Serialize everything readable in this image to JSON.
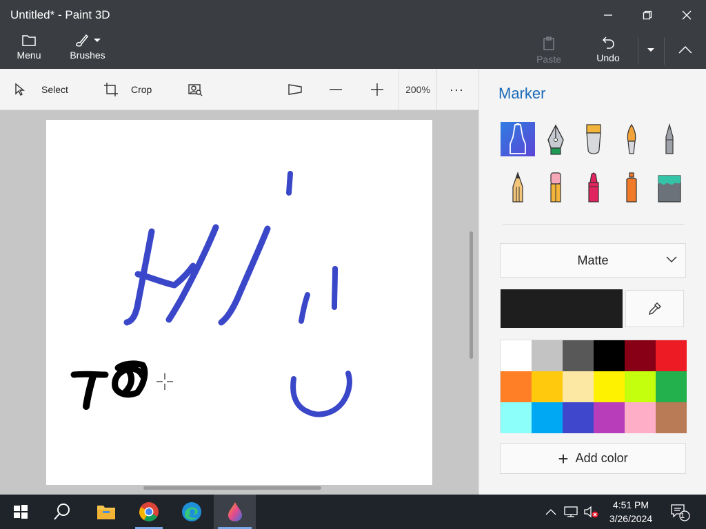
{
  "window": {
    "title": "Untitled* - Paint 3D"
  },
  "commandbar": {
    "menu_label": "Menu",
    "brushes_label": "Brushes",
    "paste_label": "Paste",
    "undo_label": "Undo"
  },
  "toolbar": {
    "select_label": "Select",
    "crop_label": "Crop",
    "zoom_value": "200%",
    "more_label": "···"
  },
  "panel": {
    "title": "Marker",
    "finish_value": "Matte",
    "current_color": "#1e1e1e",
    "add_color_label": "Add color",
    "brushes": [
      {
        "icon": "marker-brush-icon",
        "selected": true
      },
      {
        "icon": "calligraphy-pen-icon",
        "selected": false
      },
      {
        "icon": "oil-brush-icon",
        "selected": false
      },
      {
        "icon": "watercolor-brush-icon",
        "selected": false
      },
      {
        "icon": "pixel-pen-icon",
        "selected": false
      },
      {
        "icon": "pencil-icon",
        "selected": false
      },
      {
        "icon": "eraser-icon",
        "selected": false
      },
      {
        "icon": "crayon-icon",
        "selected": false
      },
      {
        "icon": "spray-can-icon",
        "selected": false
      },
      {
        "icon": "fill-bucket-icon",
        "selected": false
      }
    ],
    "palette": [
      "#ffffff",
      "#c3c3c3",
      "#585858",
      "#000000",
      "#880015",
      "#ed1c24",
      "#ff7f27",
      "#ffc90e",
      "#fde8a3",
      "#fff200",
      "#c4ff0e",
      "#22b14c",
      "#8cfffb",
      "#00a8f3",
      "#3f48cc",
      "#b83dba",
      "#ffaec8",
      "#b97a56"
    ]
  },
  "canvas": {
    "stroke_colors": {
      "blue": "#3a47c8",
      "black": "#000000"
    }
  },
  "taskbar": {
    "time": "4:51 PM",
    "date": "3/26/2024",
    "notification_count": "1"
  }
}
